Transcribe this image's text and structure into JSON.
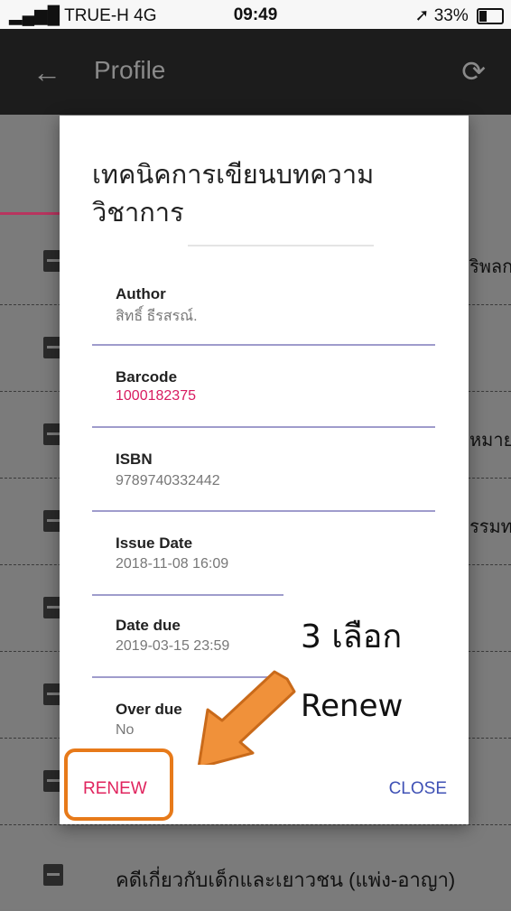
{
  "status": {
    "carrier": "TRUE-H  4G",
    "time": "09:49",
    "battery": "33%"
  },
  "appbar": {
    "back_icon": "←",
    "title": "Profile",
    "refresh_icon": "⟳"
  },
  "background_list": {
    "row_texts": [
      "",
      "",
      "",
      "",
      "",
      "",
      "",
      "คดีเกี่ยวกับเด็กและเยาวชน (แพ่ง-อาญา)"
    ],
    "edge_texts": [
      "ริพลก",
      "",
      "หมาย",
      "รรมท",
      "",
      "",
      "",
      ""
    ]
  },
  "dialog": {
    "title": "เทคนิคการเขียนบทความวิชาการ",
    "fields": [
      {
        "label": "Author",
        "value": "สิทธิ์ ธีรสรณ์."
      },
      {
        "label": "Barcode",
        "value": "1000182375"
      },
      {
        "label": "ISBN",
        "value": "9789740332442"
      },
      {
        "label": "Issue Date",
        "value": "2018-11-08 16:09"
      },
      {
        "label": "Date due",
        "value": "2019-03-15 23:59"
      },
      {
        "label": "Over due",
        "value": "No"
      }
    ],
    "renew_label": "RENEW",
    "close_label": "CLOSE"
  },
  "annotation": {
    "line1": "3 เลือก",
    "line2": "Renew",
    "highlight_color": "#e77a1a",
    "arrow_color": "#f0913a"
  }
}
